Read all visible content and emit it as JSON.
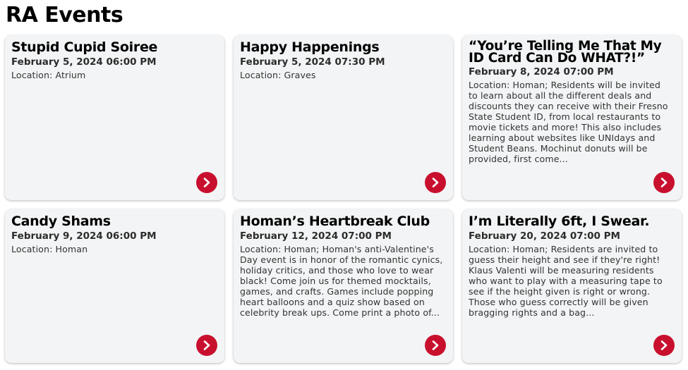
{
  "page": {
    "title": "RA Events"
  },
  "colors": {
    "accent": "#c8102e",
    "card_bg": "#f3f4f5"
  },
  "events": [
    {
      "title": "Stupid Cupid Soiree",
      "date": "February 5, 2024 06:00 PM",
      "description": "Location: Atrium",
      "button_icon": "chevron-right-icon"
    },
    {
      "title": "Happy Happenings",
      "date": "February 5, 2024 07:30 PM",
      "description": "Location: Graves",
      "button_icon": "chevron-right-icon"
    },
    {
      "title": "“You’re Telling Me That My ID Card Can Do WHAT?!”",
      "date": "February 8, 2024 07:00 PM",
      "description": "Location: Homan; Residents will be invited to learn about all the different deals and discounts they can receive with their Fresno State Student ID, from local restaurants to movie tickets and more! This also includes learning about websites like UNIdays and Student Beans. Mochinut donuts will be provided, first come...",
      "button_icon": "chevron-right-icon"
    },
    {
      "title": "Candy Shams",
      "date": "February 9, 2024 06:00 PM",
      "description": "Location: Homan",
      "button_icon": "chevron-right-icon"
    },
    {
      "title": "Homan’s Heartbreak Club",
      "date": "February 12, 2024 07:00 PM",
      "description": "Location: Homan; Homan's anti-Valentine's Day event is in honor of the romantic cynics, holiday critics, and those who love to wear black! Come join us for themed mocktails, games, and crafts. Games include popping heart balloons and a quiz show based on celebrity break ups. Come print a photo of...",
      "button_icon": "chevron-right-icon"
    },
    {
      "title": "I’m Literally 6ft, I Swear.",
      "date": "February 20, 2024 07:00 PM",
      "description": "Location: Homan; Residents are invited to guess their height and see if they're right! Klaus Valenti will be measuring residents who want to play with a measuring tape to see if the height given is right or wrong. Those who guess correctly will be given bragging rights and a bag...",
      "button_icon": "chevron-right-icon"
    }
  ]
}
